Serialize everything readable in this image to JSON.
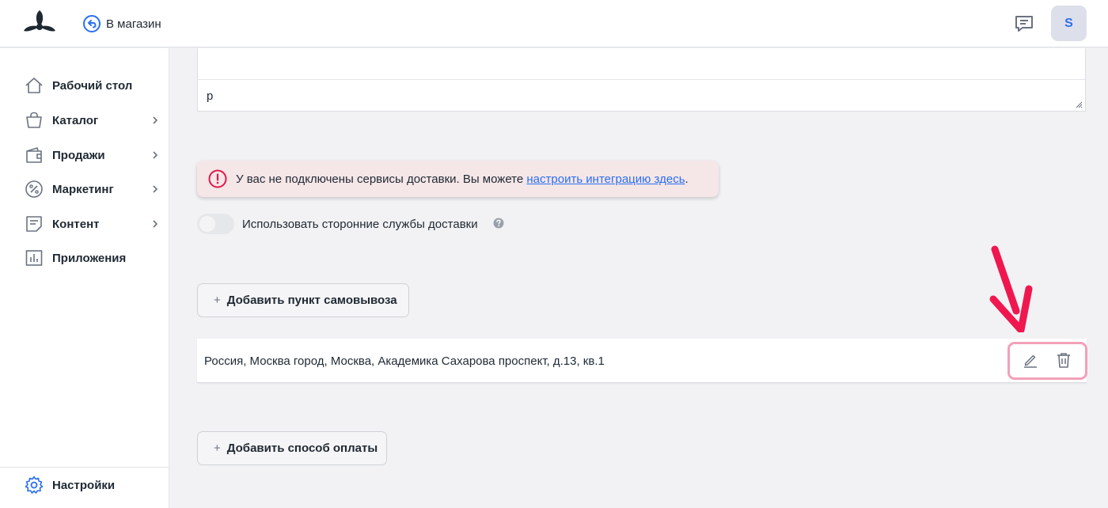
{
  "header": {
    "back_label": "В магазин",
    "avatar_letter": "S"
  },
  "sidebar": {
    "items": [
      {
        "label": "Рабочий стол",
        "icon": "home-icon"
      },
      {
        "label": "Каталог",
        "icon": "bag-icon"
      },
      {
        "label": "Продажи",
        "icon": "wallet-icon"
      },
      {
        "label": "Маркетинг",
        "icon": "percent-icon"
      },
      {
        "label": "Контент",
        "icon": "document-icon"
      },
      {
        "label": "Приложения",
        "icon": "chart-icon"
      }
    ],
    "settings_label": "Настройки"
  },
  "form": {
    "textarea_value": "р"
  },
  "alert": {
    "text": "У вас не подключены сервисы доставки. Вы можете ",
    "link": "настроить интеграцию здесь",
    "suffix": "."
  },
  "delivery": {
    "toggle_label": "Использовать сторонние службы доставки"
  },
  "pickup": {
    "add_label": "Добавить пункт самовывоза",
    "address": "Россия, Москва город, Москва, Академика Сахарова проспект, д.13, кв.1"
  },
  "payment": {
    "add_label": "Добавить способ оплаты"
  },
  "colors": {
    "accent": "#2b6ff2",
    "alert_bg": "#f5e6e7",
    "alert_icon": "#e0184a",
    "annotation": "#f0174f"
  }
}
